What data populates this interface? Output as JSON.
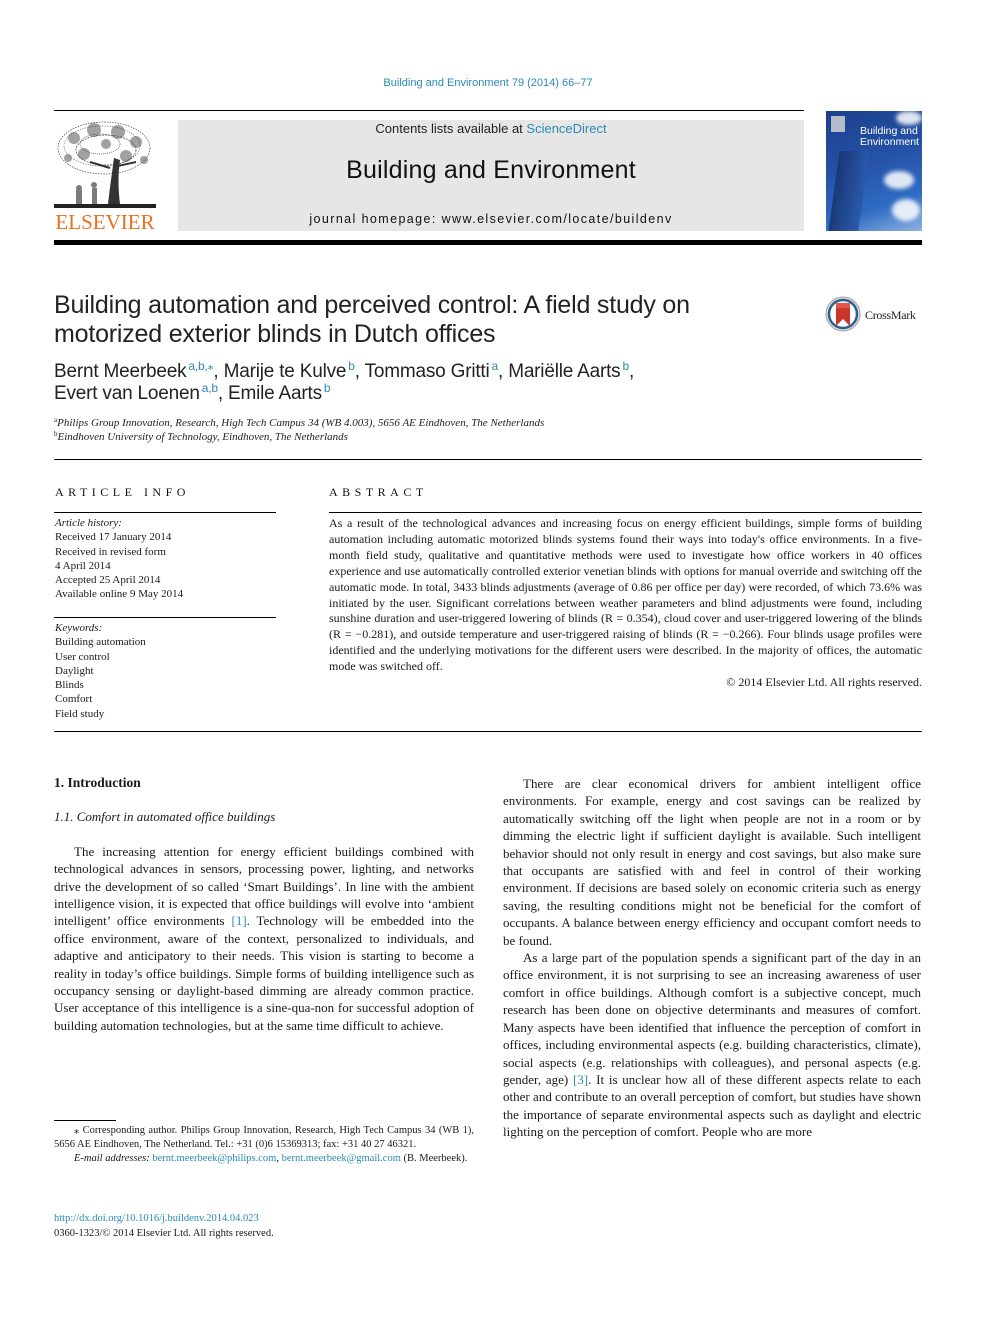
{
  "citation": "Building and Environment 79 (2014) 66–77",
  "header": {
    "publisher": "ELSEVIER",
    "contents_prefix": "Contents lists available at ",
    "contents_link": "ScienceDirect",
    "journal_name": "Building and Environment",
    "homepage_label": "journal homepage: ",
    "homepage_url": "www.elsevier.com/locate/buildenv",
    "cover_title_line1": "Building and",
    "cover_title_line2": "Environment",
    "accent_color": "#2a8ab6",
    "publisher_color": "#e9711c"
  },
  "article": {
    "title_line1": "Building automation and perceived control: A field study on",
    "title_line2": "motorized exterior blinds in Dutch offices",
    "crossmark_label": "CrossMark",
    "authors": [
      {
        "name": "Bernt Meerbeek",
        "sup": "a,b,⁎",
        "sep": ", "
      },
      {
        "name": "Marije te Kulve",
        "sup": "b",
        "sep": ", "
      },
      {
        "name": "Tommaso Gritti",
        "sup": "a",
        "sep": ", "
      },
      {
        "name": "Mariëlle Aarts",
        "sup": "b",
        "sep": ","
      },
      {
        "name": "Evert van Loenen",
        "sup": "a,b",
        "sep": ", "
      },
      {
        "name": "Emile Aarts",
        "sup": "b",
        "sep": ""
      }
    ],
    "affiliations": [
      {
        "mark": "a",
        "text": "Philips Group Innovation, Research, High Tech Campus 34 (WB 4.003), 5656 AE Eindhoven, The Netherlands"
      },
      {
        "mark": "b",
        "text": "Eindhoven University of Technology, Eindhoven, The Netherlands"
      }
    ]
  },
  "article_info": {
    "heading": "ARTICLE INFO",
    "history_label": "Article history:",
    "history": [
      "Received 17 January 2014",
      "Received in revised form",
      "4 April 2014",
      "Accepted 25 April 2014",
      "Available online 9 May 2014"
    ],
    "keywords_label": "Keywords:",
    "keywords": [
      "Building automation",
      "User control",
      "Daylight",
      "Blinds",
      "Comfort",
      "Field study"
    ]
  },
  "abstract": {
    "heading": "ABSTRACT",
    "text": "As a result of the technological advances and increasing focus on energy efficient buildings, simple forms of building automation including automatic motorized blinds systems found their ways into today's office environments. In a five-month field study, qualitative and quantitative methods were used to investigate how office workers in 40 offices experience and use automatically controlled exterior venetian blinds with options for manual override and switching off the automatic mode. In total, 3433 blinds adjustments (average of 0.86 per office per day) were recorded, of which 73.6% was initiated by the user. Significant correlations between weather parameters and blind adjustments were found, including sunshine duration and user-triggered lowering of blinds (R = 0.354), cloud cover and user-triggered lowering of the blinds (R = −0.281), and outside temperature and user-triggered raising of blinds (R = −0.266). Four blinds usage profiles were identified and the underlying motivations for the different users were described. In the majority of offices, the automatic mode was switched off.",
    "copyright": "© 2014 Elsevier Ltd. All rights reserved."
  },
  "body": {
    "section1_heading": "1.  Introduction",
    "section11_heading": "1.1.  Comfort in automated office buildings",
    "left_para1_a": "The increasing attention for energy efficient buildings combined with technological advances in sensors, processing power, lighting, and networks drive the development of so called ‘Smart Buildings’. In line with the ambient intelligence vision, it is expected that office buildings will evolve into ‘ambient intelligent’ office environments ",
    "left_para1_ref": "[1]",
    "left_para1_b": ". Technology will be embedded into the office environment, aware of the context, personalized to individuals, and adaptive and anticipatory to their needs. This vision is starting to become a reality in today’s office buildings. Simple forms of building intelligence such as occupancy sensing or daylight-based dimming are already common practice. User acceptance of this intelligence is a sine-qua-non for successful adoption of building automation technologies, but at the same time difficult to achieve.",
    "right_para1": "There are clear economical drivers for ambient intelligent office environments. For example, energy and cost savings can be realized by automatically switching off the light when people are not in a room or by dimming the electric light if sufficient daylight is available. Such intelligent behavior should not only result in energy and cost savings, but also make sure that occupants are satisfied with and feel in control of their working environment. If decisions are based solely on economic criteria such as energy saving, the resulting conditions might not be beneficial for the comfort of occupants. A balance between energy efficiency and occupant comfort needs to be found.",
    "right_para2_a": "As a large part of the population spends a significant part of the day in an office environment, it is not surprising to see an increasing awareness of user comfort in office buildings. Although comfort is a subjective concept, much research has been done on objective determinants and measures of comfort. Many aspects have been identified that influence the perception of comfort in offices, including environmental aspects (e.g. building characteristics, climate), social aspects (e.g. relationships with colleagues), and personal aspects (e.g. gender, age) ",
    "right_para2_ref": "[3]",
    "right_para2_b": ". It is unclear how all of these different aspects relate to each other and contribute to an overall perception of comfort, but studies have shown the importance of separate environmental aspects such as daylight and electric lighting on the perception of comfort. People who are more"
  },
  "footnotes": {
    "corresponding": "⁎ Corresponding author. Philips Group Innovation, Research, High Tech Campus 34 (WB 1), 5656 AE Eindhoven, The Netherland. Tel.: +31 (0)6 15369313; fax: +31 40 27 46321.",
    "email_label": "E-mail addresses: ",
    "email1": "bernt.meerbeek@philips.com",
    "email_sep": ", ",
    "email2": "bernt.meerbeek@gmail.com",
    "email_owner": " (B. Meerbeek).",
    "doi": "http://dx.doi.org/10.1016/j.buildenv.2014.04.023",
    "issn": "0360-1323/© 2014 Elsevier Ltd. All rights reserved."
  }
}
